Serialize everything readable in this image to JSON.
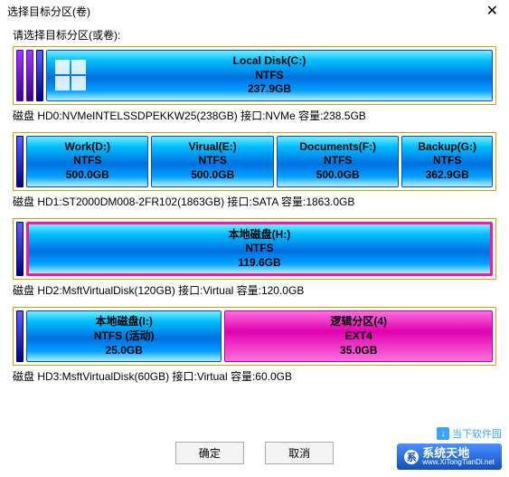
{
  "window": {
    "title": "选择目标分区(卷)",
    "prompt": "请选择目标分区(或卷):"
  },
  "disks": [
    {
      "info": "磁盘 HD0:NVMeINTELSSDPEKKW25(238GB)  接口:NVMe  容量:238.5GB",
      "reserved": [
        "purple",
        "purple",
        "blue"
      ],
      "parts": [
        {
          "name": "Local Disk(C:)",
          "fs": "NTFS",
          "size": "237.9GB",
          "icon": "windows",
          "flex": 1
        }
      ]
    },
    {
      "info": "磁盘 HD1:ST2000DM008-2FR102(1863GB)  接口:SATA  容量:1863.0GB",
      "reserved": [
        "blue"
      ],
      "parts": [
        {
          "name": "Work(D:)",
          "fs": "NTFS",
          "size": "500.0GB",
          "flex": 1
        },
        {
          "name": "Virual(E:)",
          "fs": "NTFS",
          "size": "500.0GB",
          "flex": 1
        },
        {
          "name": "Documents(F:)",
          "fs": "NTFS",
          "size": "500.0GB",
          "flex": 1
        },
        {
          "name": "Backup(G:)",
          "fs": "NTFS",
          "size": "362.9GB",
          "flex": 0.73
        }
      ]
    },
    {
      "info": "磁盘 HD2:MsftVirtualDisk(120GB)  接口:Virtual  容量:120.0GB",
      "reserved": [
        "blue"
      ],
      "parts": [
        {
          "name": "本地磁盘(H:)",
          "fs": "NTFS",
          "size": "119.6GB",
          "flex": 1,
          "selected": true
        }
      ]
    },
    {
      "info": "磁盘 HD3:MsftVirtualDisk(60GB)  接口:Virtual  容量:60.0GB",
      "reserved": [
        "blue"
      ],
      "parts": [
        {
          "name": "本地磁盘(I:)",
          "fs": "NTFS (活动)",
          "size": "25.0GB",
          "flex": 0.42
        },
        {
          "name": "逻辑分区(4)",
          "fs": "EXT4",
          "size": "35.0GB",
          "flex": 0.58,
          "type": "ext4"
        }
      ]
    }
  ],
  "buttons": {
    "ok": "确定",
    "cancel": "取消"
  },
  "watermark1": "当下软件园",
  "watermark2": "系统天地",
  "watermark2_url": "www.XiTongTianDi.net"
}
